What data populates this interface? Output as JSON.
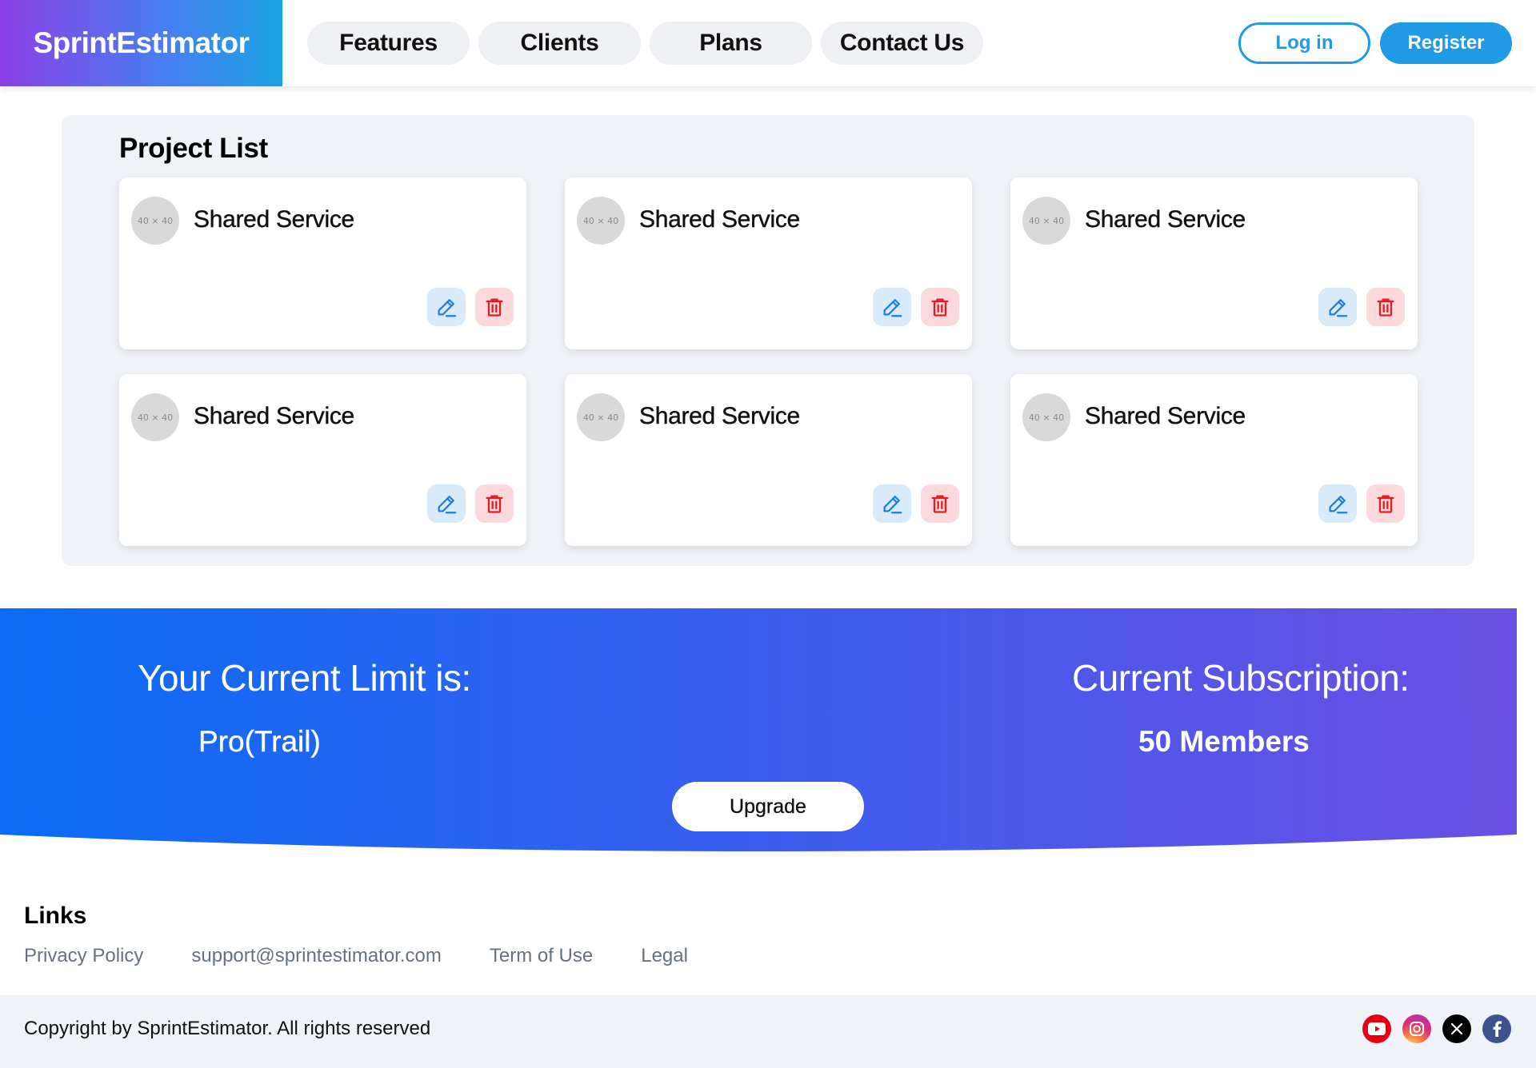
{
  "header": {
    "brand": "SprintEstimator",
    "nav": [
      "Features",
      "Clients",
      "Plans",
      "Contact Us"
    ],
    "login_label": "Log in",
    "register_label": "Register"
  },
  "projects": {
    "title": "Project List",
    "avatar_placeholder": "40 × 40",
    "cards": [
      {
        "title": "Shared Service"
      },
      {
        "title": "Shared Service"
      },
      {
        "title": "Shared Service"
      },
      {
        "title": "Shared Service"
      },
      {
        "title": "Shared Service"
      },
      {
        "title": "Shared Service"
      }
    ],
    "edit_icon": "pencil-icon",
    "delete_icon": "trash-icon"
  },
  "subscription": {
    "limit_label": "Your Current Limit is:",
    "limit_value": "Pro(Trail)",
    "subscription_label": "Current Subscription:",
    "subscription_value": "50 Members",
    "upgrade_label": "Upgrade",
    "gradient_start": "#0a6cf6",
    "gradient_end": "#6a4fe4"
  },
  "footer": {
    "links_title": "Links",
    "links": [
      "Privacy Policy",
      "support@sprintestimator.com",
      "Term of Use",
      "Legal"
    ],
    "copyright": "Copyright by SprintEstimator. All rights reserved",
    "socials": [
      "youtube-icon",
      "instagram-icon",
      "x-icon",
      "facebook-icon"
    ]
  },
  "colors": {
    "accent": "#1f9be6",
    "edit_icon": "#1a7fe0",
    "delete_icon": "#e31b23"
  }
}
